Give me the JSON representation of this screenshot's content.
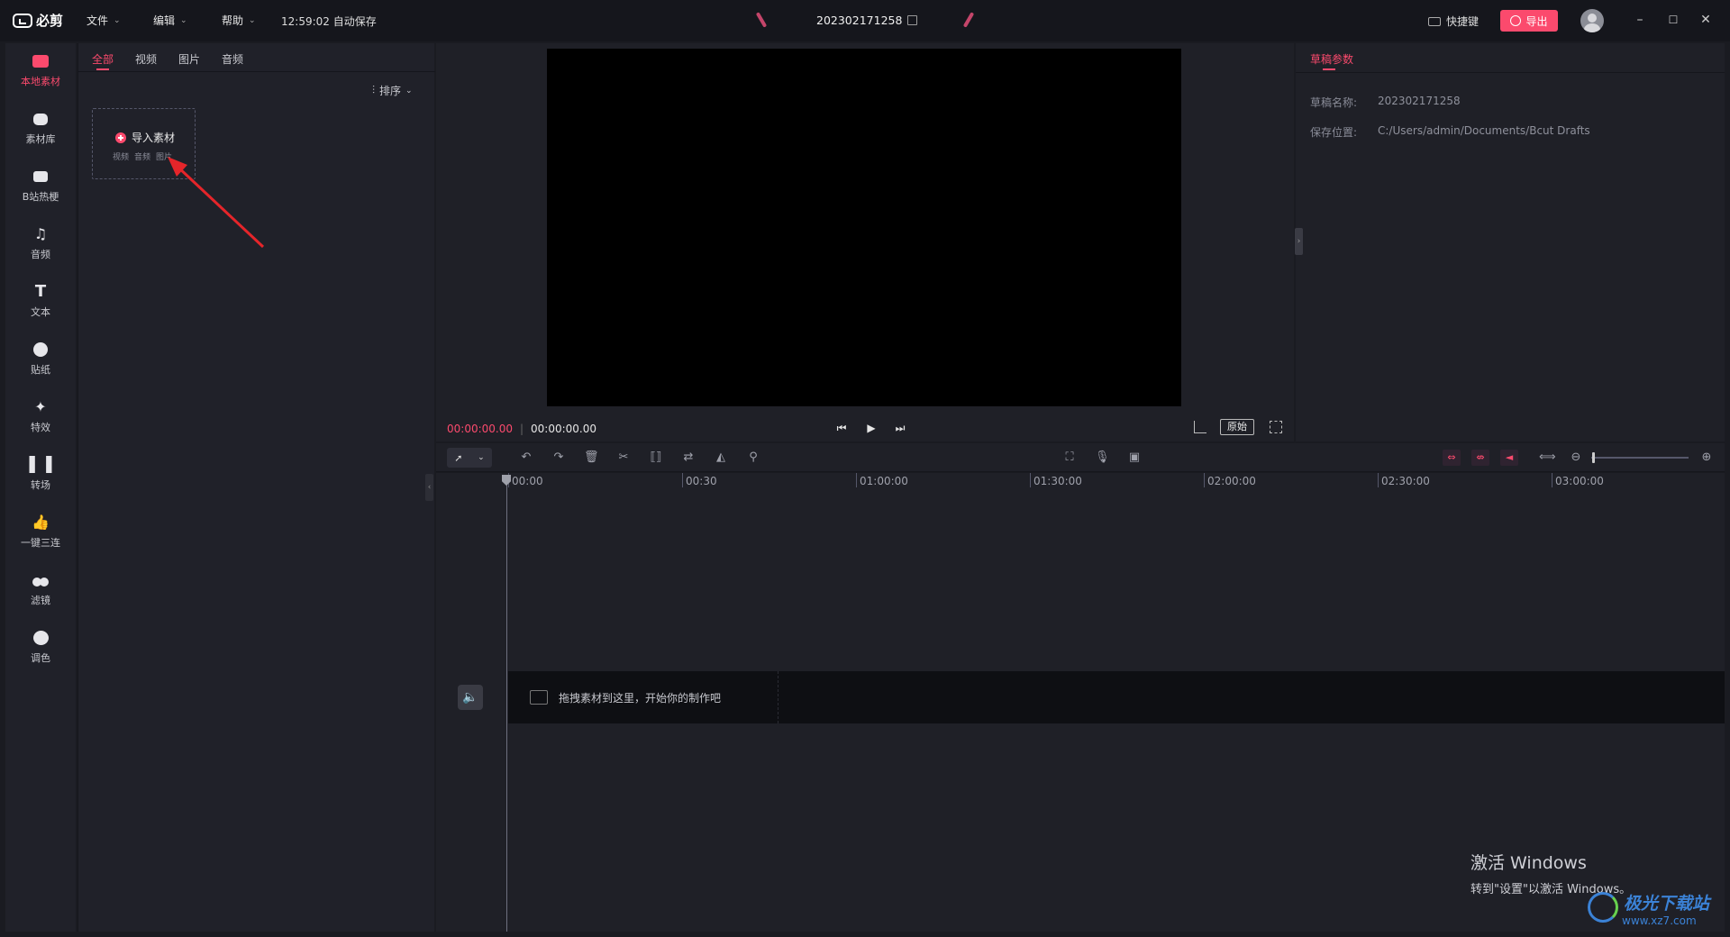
{
  "app": {
    "name": "必剪"
  },
  "menus": {
    "file": "文件",
    "edit": "编辑",
    "help": "帮助"
  },
  "autosave": "12:59:02 自动保存",
  "project_title": "202302171258",
  "shortcut_label": "快捷键",
  "export_label": "导出",
  "window": {
    "minimize": "–",
    "maximize": "☐",
    "close": "✕"
  },
  "rail": [
    {
      "label": "本地素材",
      "icon": "local-media-icon",
      "active": true
    },
    {
      "label": "素材库",
      "icon": "material-library-icon"
    },
    {
      "label": "B站热梗",
      "icon": "bilibili-meme-icon"
    },
    {
      "label": "音频",
      "icon": "music-note-icon"
    },
    {
      "label": "文本",
      "icon": "text-t-icon"
    },
    {
      "label": "贴纸",
      "icon": "sticker-icon"
    },
    {
      "label": "特效",
      "icon": "effects-star-icon"
    },
    {
      "label": "转场",
      "icon": "transition-icon"
    },
    {
      "label": "一键三连",
      "icon": "thumbs-up-icon"
    },
    {
      "label": "滤镜",
      "icon": "filter-icon"
    },
    {
      "label": "调色",
      "icon": "palette-icon"
    }
  ],
  "media": {
    "tabs": [
      "全部",
      "视频",
      "图片",
      "音频"
    ],
    "sort_label": "排序",
    "import_label": "导入素材",
    "import_types": [
      "视频",
      "音频",
      "图片"
    ]
  },
  "preview": {
    "current_time": "00:00:00.00",
    "separator": "|",
    "total_time": "00:00:00.00",
    "original_label": "原始"
  },
  "params": {
    "tab": "草稿参数",
    "name_label": "草稿名称:",
    "name_value": "202302171258",
    "path_label": "保存位置:",
    "path_value": "C:/Users/admin/Documents/Bcut Drafts"
  },
  "timeline": {
    "ticks": [
      "00:00",
      "00:30",
      "01:00:00",
      "01:30:00",
      "02:00:00",
      "02:30:00",
      "03:00:00"
    ],
    "drop_hint": "拖拽素材到这里，开始你的制作吧"
  },
  "activation": {
    "line1": "激活 Windows",
    "line2": "转到\"设置\"以激活 Windows。"
  },
  "watermark": {
    "text": "极光下载站",
    "url": "www.xz7.com"
  },
  "colors": {
    "accent": "#fb4a6d",
    "background": "#1a1b21",
    "panel": "#202129"
  }
}
